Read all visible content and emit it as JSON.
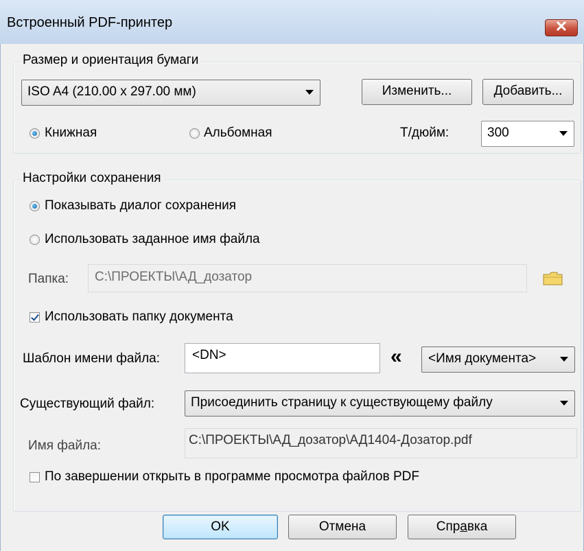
{
  "window": {
    "title": "Встроенный PDF-принтер",
    "close_label": "✕"
  },
  "paper": {
    "group_label": "Размер и ориентация бумаги",
    "size_value": "ISO A4 (210.00 x 297.00 мм)",
    "change_button": "Изменить...",
    "add_button": "Добавить...",
    "portrait_label": "Книжная",
    "landscape_label": "Альбомная",
    "orientation_selected": "portrait",
    "dpi_label": "Т/дюйм:",
    "dpi_value": "300"
  },
  "save": {
    "group_label": "Настройки сохранения",
    "show_dialog_label": "Показывать диалог сохранения",
    "use_name_label": "Использовать заданное имя файла",
    "folder_label": "Папка:",
    "folder_value": "C:\\ПРОЕКТЫ\\АД_дозатор",
    "use_doc_folder_label": "Использовать папку документа",
    "use_doc_folder_checked": true,
    "template_label": "Шаблон имени файла:",
    "template_value": "<DN>",
    "insert_symbol": "«",
    "template_macro": "<Имя документа>",
    "existing_label": "Существующий файл:",
    "existing_value": "Присоединить страницу к существующему файлу",
    "filename_label": "Имя файла:",
    "filename_value": "C:\\ПРОЕКТЫ\\АД_дозатор\\АД1404-Дозатор.pdf",
    "open_after_label": "По завершении открыть в программе просмотра файлов PDF",
    "open_after_checked": false
  },
  "buttons": {
    "ok": "OK",
    "cancel": "Отмена",
    "help_pre": "Спр",
    "help_ul": "а",
    "help_post": "вка"
  }
}
